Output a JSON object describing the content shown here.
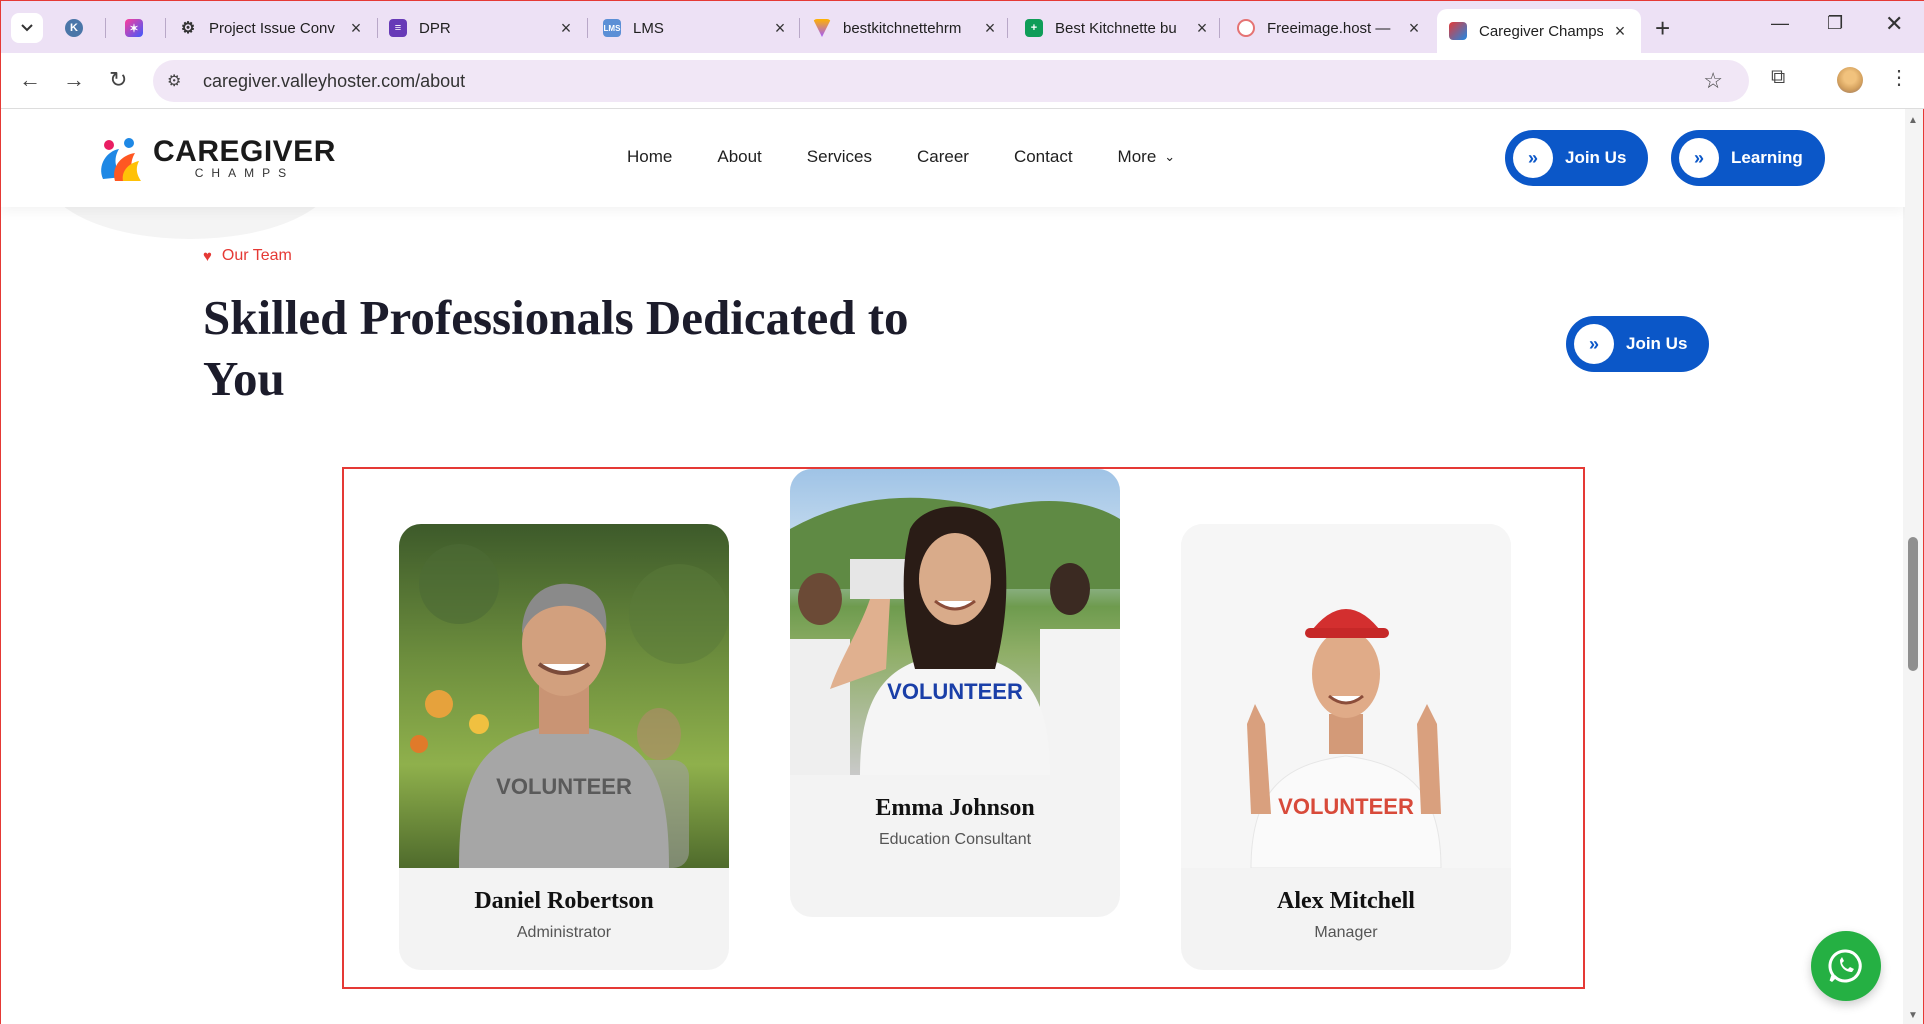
{
  "browser": {
    "tabs": [
      {
        "title": "",
        "favicon": "vk-icon",
        "color": "#4a76a8"
      },
      {
        "title": "",
        "favicon": "sparkle-icon",
        "color": "#7b3fe4"
      },
      {
        "title": "Project Issue Conv",
        "favicon": "openai-icon",
        "color": "#333333"
      },
      {
        "title": "DPR",
        "favicon": "forms-icon",
        "color": "#673ab7"
      },
      {
        "title": "LMS",
        "favicon": "lms-icon",
        "color": "#5b8fd6"
      },
      {
        "title": "bestkitchnettehrm",
        "favicon": "triangle-icon",
        "color": "#a259ff"
      },
      {
        "title": "Best Kitchnette bu",
        "favicon": "sheets-icon",
        "color": "#0f9d58"
      },
      {
        "title": "Freeimage.host —",
        "favicon": "freeimage-icon",
        "color": "#e57373"
      },
      {
        "title": "Caregiver Champs",
        "favicon": "caregiver-icon",
        "color": "#e53935"
      }
    ],
    "url": "caregiver.valleyhoster.com/about"
  },
  "header": {
    "logo_main": "CAREGIVER",
    "logo_sub": "CHAMPS",
    "nav": [
      "Home",
      "About",
      "Services",
      "Career",
      "Contact",
      "More"
    ],
    "join_label": "Join Us",
    "learning_label": "Learning"
  },
  "section": {
    "eyebrow": "Our Team",
    "heading": "Skilled Professionals Dedicated to You",
    "join_label": "Join Us"
  },
  "team": [
    {
      "name": "Daniel Robertson",
      "role": "Administrator",
      "shirt": "VOLUNTEER"
    },
    {
      "name": "Emma Johnson",
      "role": "Education Consultant",
      "shirt": "VOLUNTEER"
    },
    {
      "name": "Alex Mitchell",
      "role": "Manager",
      "shirt": "VOLUNTEER"
    }
  ]
}
